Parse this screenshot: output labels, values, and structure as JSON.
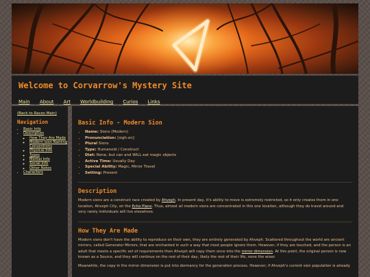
{
  "header": {
    "title": "Welcome to Corvarrow's Mystery Site",
    "nav": [
      "Main",
      "About",
      "Art",
      "Worldbuilding",
      "Curios",
      "Links"
    ]
  },
  "sidebar": {
    "back_link": "(Back to Races Main)",
    "heading": "Navigation",
    "items": [
      {
        "label": "Basic Info"
      },
      {
        "label": "Description",
        "children": [
          "How They Are Made",
          "Modern Sion Naming Conventions",
          "Physical Info",
          "Types",
          "Mental Info",
          "Social Info",
          "Other Notes"
        ]
      },
      {
        "label": "Characters"
      }
    ]
  },
  "main": {
    "basic_title": "Basic Info - Modern Sion",
    "info": [
      {
        "k": "Name:",
        "v": "Sions (Modern)"
      },
      {
        "k": "Pronunciation:",
        "v": "[sigh-on]"
      },
      {
        "k": "Plural",
        "v": "Sions"
      },
      {
        "k": "Type:",
        "v": "Humanoid / Construct"
      },
      {
        "k": "Diet:",
        "v": "None, but can and WILL eat magic objects"
      },
      {
        "k": "Active Time:",
        "v": "Usually Day"
      },
      {
        "k": "Special Ability:",
        "v": "Magic, Mirror Travel"
      },
      {
        "k": "Setting:",
        "v": "Present"
      }
    ],
    "description_title": "Description",
    "description": {
      "p1": "Modern sions are a construct race created by ",
      "l1": "Ahveph",
      "p2": ". In present day, it's ability to move is extremely restricted, so it only creates them in one location, Ahveph City, on the ",
      "l2": "Echo Plane",
      "p3": ". Thus, almost all modern sions are concentrated in this one location, although they do travel around and very rarely individuals will live elsewhere."
    },
    "made_title": "How They Are Made",
    "made": {
      "p1": "Modern sions don't have the ability to reproduce on their own, they are entirely generated by Ahveph. Scattered throughout the world are ancient mirrors, called Generator Mirrors, that are enchanted in such a way that most people ignore them. However, if they are touched, and the person is an adult that meets a specific set of requirements then Ahveph will copy them once into the ",
      "l1": "mirror dimension",
      "p2": ". At this point, the original person is now known as a Source, and they will continue on the rest of their day, likely the rest of their life, none the wiser.",
      "p3": "Meanwhile, the copy in the mirror dimension is put into dormancy for the generation process. However, if Ahveph's current sion population is already"
    }
  }
}
